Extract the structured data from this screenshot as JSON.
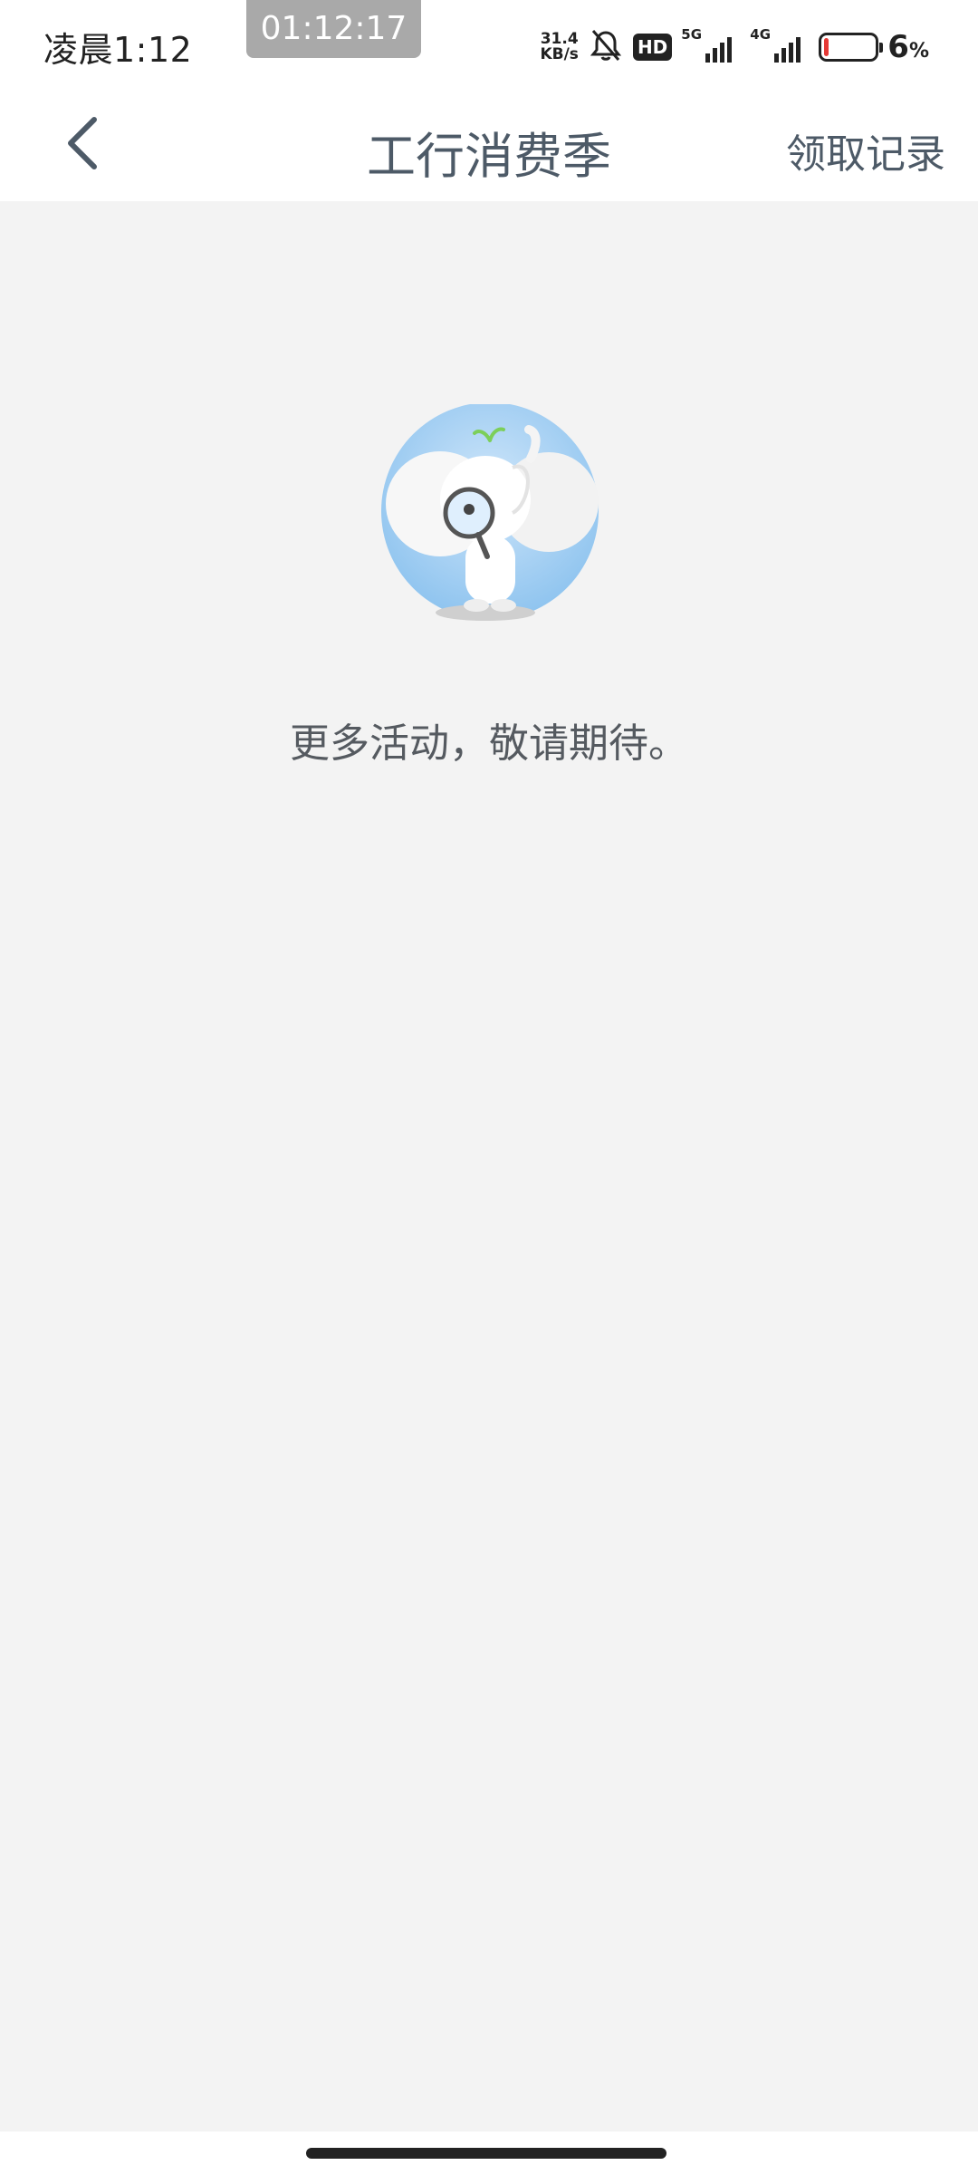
{
  "status_bar": {
    "time": "凌晨1:12",
    "recording_timer": "01:12:17",
    "net_speed_value": "31.4",
    "net_speed_unit": "KB/s",
    "hd_label": "HD",
    "sim1_label": "5G",
    "sim2_label": "4G",
    "battery_value": "6",
    "battery_unit": "%",
    "battery_color": "#e53935"
  },
  "nav": {
    "back_icon": "chevron-left-icon",
    "title": "工行消费季",
    "action_label": "领取记录"
  },
  "empty_state": {
    "illustration": "elephant-magnifier-mascot",
    "message": "更多活动，敬请期待。"
  },
  "colors": {
    "nav_text": "#4d5a67",
    "page_background": "#f3f3f3"
  }
}
